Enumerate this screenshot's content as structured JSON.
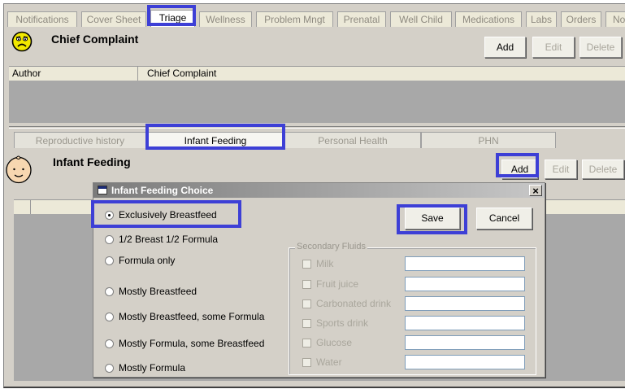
{
  "top_tabs": [
    {
      "label": "Notifications"
    },
    {
      "label": "Cover Sheet"
    },
    {
      "label": "Triage"
    },
    {
      "label": "Wellness"
    },
    {
      "label": "Problem Mngt"
    },
    {
      "label": "Prenatal"
    },
    {
      "label": "Well Child"
    },
    {
      "label": "Medications"
    },
    {
      "label": "Labs"
    },
    {
      "label": "Orders"
    },
    {
      "label": "No"
    }
  ],
  "chief_complaint": {
    "title": "Chief Complaint",
    "add": "Add",
    "edit": "Edit",
    "delete": "Delete",
    "columns": [
      "Author",
      "Chief Complaint"
    ]
  },
  "sub_tabs": [
    {
      "label": "Reproductive history"
    },
    {
      "label": "Infant Feeding"
    },
    {
      "label": "Personal Health"
    },
    {
      "label": "PHN"
    }
  ],
  "infant_feeding": {
    "title": "Infant Feeding",
    "add": "Add",
    "edit": "Edit",
    "delete": "Delete"
  },
  "dialog": {
    "title": "Infant Feeding Choice",
    "close": "×",
    "save": "Save",
    "cancel": "Cancel",
    "options": [
      {
        "label": "Exclusively Breastfeed",
        "selected": true
      },
      {
        "label": "1/2 Breast 1/2 Formula",
        "selected": false
      },
      {
        "label": "Formula only",
        "selected": false
      },
      {
        "label": "Mostly Breastfeed",
        "selected": false
      },
      {
        "label": "Mostly Breastfeed, some Formula",
        "selected": false
      },
      {
        "label": "Mostly Formula, some Breastfeed",
        "selected": false
      },
      {
        "label": "Mostly Formula",
        "selected": false
      }
    ],
    "secondary": {
      "title": "Secondary Fluids",
      "items": [
        {
          "label": "Milk",
          "value": ""
        },
        {
          "label": "Fruit juice",
          "value": ""
        },
        {
          "label": "Carbonated drink",
          "value": ""
        },
        {
          "label": "Sports drink",
          "value": ""
        },
        {
          "label": "Glucose",
          "value": ""
        },
        {
          "label": "Water",
          "value": ""
        }
      ]
    }
  },
  "colors": {
    "highlight": "#3d3fd6",
    "window_bg": "#d4d0c8",
    "grid_bg": "#a8a8a8"
  }
}
